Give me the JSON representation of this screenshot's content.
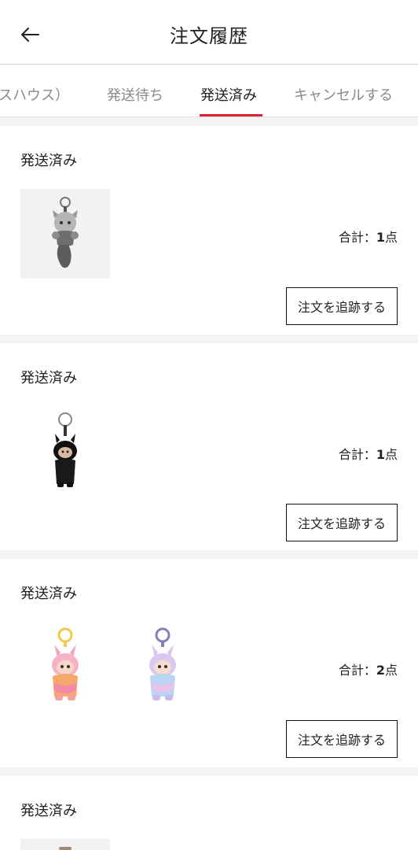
{
  "header": {
    "title": "注文履歴",
    "back_icon": "arrow-left-icon"
  },
  "tabs": [
    {
      "label": "スハウス）",
      "active": false
    },
    {
      "label": "発送待ち",
      "active": false
    },
    {
      "label": "発送済み",
      "active": true
    },
    {
      "label": "キャンセルする",
      "active": false
    }
  ],
  "accent_color": "#d9232e",
  "orders": [
    {
      "status": "発送済み",
      "items": [
        {
          "name": "grey-wolf-keychain-icon"
        }
      ],
      "total_label": "合計：",
      "total_count": "1",
      "total_unit": "点",
      "track_label": "注文を追跡する"
    },
    {
      "status": "発送済み",
      "items": [
        {
          "name": "black-labubu-keychain-icon"
        }
      ],
      "total_label": "合計：",
      "total_count": "1",
      "total_unit": "点",
      "track_label": "注文を追跡する"
    },
    {
      "status": "発送済み",
      "items": [
        {
          "name": "pink-rainbow-labubu-keychain-icon"
        },
        {
          "name": "pastel-labubu-keychain-icon"
        }
      ],
      "total_label": "合計：",
      "total_count": "2",
      "total_unit": "点",
      "track_label": "注文を追跡する"
    },
    {
      "status": "発送済み",
      "items": [
        {
          "name": "product-thumbnail"
        }
      ]
    }
  ]
}
